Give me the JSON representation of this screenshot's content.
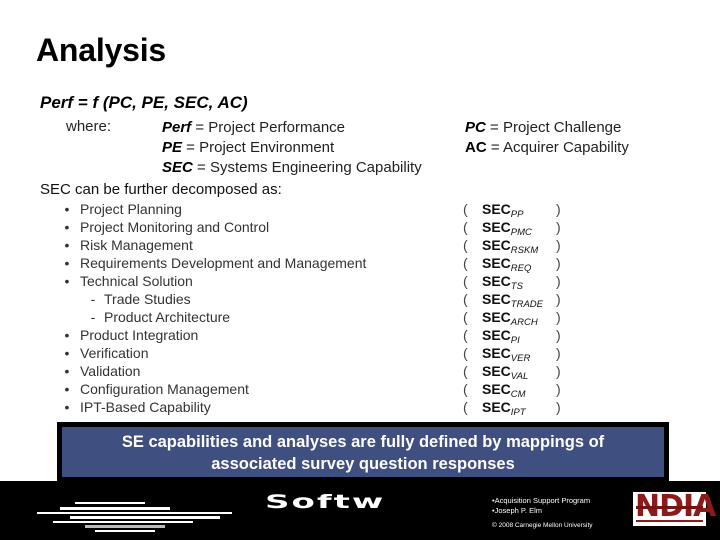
{
  "slide": {
    "title": "Analysis",
    "formula": "Perf = f (PC, PE, SEC, AC)",
    "where_label": "where:",
    "definitions_left": [
      {
        "term": "Perf",
        "desc": " = Project Performance"
      },
      {
        "term": "PE",
        "desc": " = Project Environment"
      },
      {
        "term": "SEC",
        "desc": " = Systems Engineering Capability"
      }
    ],
    "definitions_right": [
      {
        "term": "PC",
        "desc": " = Project Challenge"
      },
      {
        "term": "AC",
        "desc": " = Acquirer Capability"
      }
    ],
    "decomposition_heading": "SEC can be further decomposed as:",
    "decomposition": [
      {
        "label": "Project Planning",
        "level": 1,
        "abbr": "SEC",
        "sub": "PP"
      },
      {
        "label": "Project Monitoring and Control",
        "level": 1,
        "abbr": "SEC",
        "sub": "PMC"
      },
      {
        "label": "Risk Management",
        "level": 1,
        "abbr": "SEC",
        "sub": "RSKM"
      },
      {
        "label": "Requirements Development and Management",
        "level": 1,
        "abbr": "SEC",
        "sub": "REQ"
      },
      {
        "label": "Technical Solution",
        "level": 1,
        "abbr": "SEC",
        "sub": "TS"
      },
      {
        "label": "Trade Studies",
        "level": 2,
        "abbr": "SEC",
        "sub": "TRADE"
      },
      {
        "label": "Product Architecture",
        "level": 2,
        "abbr": "SEC",
        "sub": "ARCH"
      },
      {
        "label": "Product Integration",
        "level": 1,
        "abbr": "SEC",
        "sub": "PI"
      },
      {
        "label": "Verification",
        "level": 1,
        "abbr": "SEC",
        "sub": "VER"
      },
      {
        "label": "Validation",
        "level": 1,
        "abbr": "SEC",
        "sub": "VAL"
      },
      {
        "label": "Configuration Management",
        "level": 1,
        "abbr": "SEC",
        "sub": "CM"
      },
      {
        "label": "IPT-Based Capability",
        "level": 1,
        "abbr": "SEC",
        "sub": "IPT"
      }
    ],
    "bullet_glyph": "•",
    "sub_bullet_glyph": "-",
    "paren_open": "(",
    "paren_close": ")",
    "callout_line1": "SE capabilities and analyses are fully defined by mappings of",
    "callout_line2": "associated survey question responses",
    "callout_color": "#3f4f7f"
  },
  "footer": {
    "logo_text": "Softw",
    "info_line1": "•Acquisition Support Program",
    "info_line2": "•Joseph P. Elm",
    "copyright": "© 2008 Carnegie Mellon University",
    "partner_logo": "NDIA",
    "partner_color": "#8b1a1a"
  }
}
